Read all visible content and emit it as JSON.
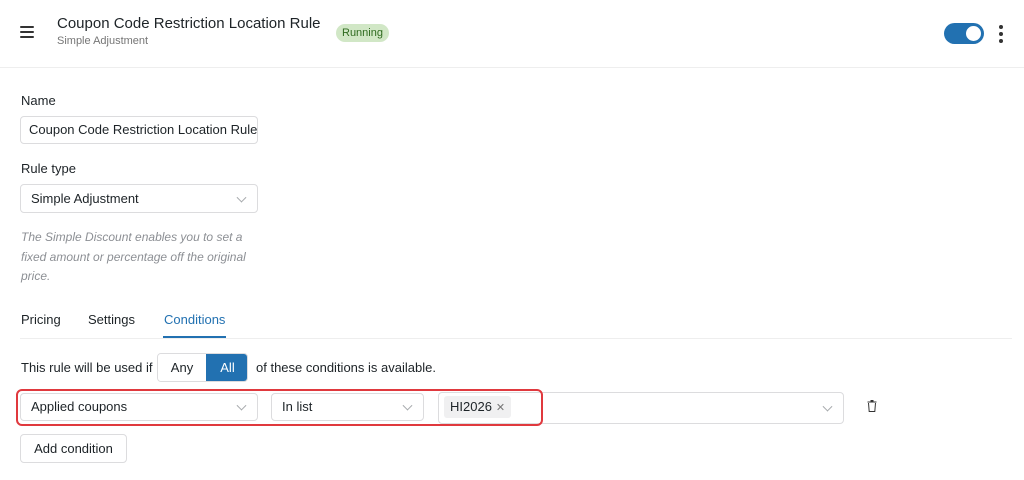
{
  "header": {
    "title": "Coupon Code Restriction Location Rule",
    "subtitle": "Simple Adjustment",
    "status": "Running",
    "enabled": true,
    "menu_icon": "hamburger-icon",
    "more_icon": "kebab-vertical-icon"
  },
  "form": {
    "name_label": "Name",
    "name_value": "Coupon Code Restriction Location Rule",
    "rule_type_label": "Rule type",
    "rule_type_value": "Simple Adjustment",
    "help_text": "The Simple Discount enables you to set a fixed amount or percentage off the original price."
  },
  "tabs": [
    {
      "label": "Pricing",
      "active": false
    },
    {
      "label": "Settings",
      "active": false
    },
    {
      "label": "Conditions",
      "active": true
    }
  ],
  "conditions": {
    "prefix": "This rule will be used if",
    "match_options": [
      "Any",
      "All"
    ],
    "match_selected": "All",
    "suffix": "of these conditions is available.",
    "rows": [
      {
        "field": "Applied coupons",
        "operator": "In list",
        "values": [
          "HI2026"
        ],
        "delete_icon": "trash-icon"
      }
    ],
    "add_button": "Add condition"
  },
  "colors": {
    "accent": "#2271b1",
    "status_bg": "#d1e7c6",
    "status_text": "#2f6b1f",
    "highlight": "#e0393e"
  }
}
